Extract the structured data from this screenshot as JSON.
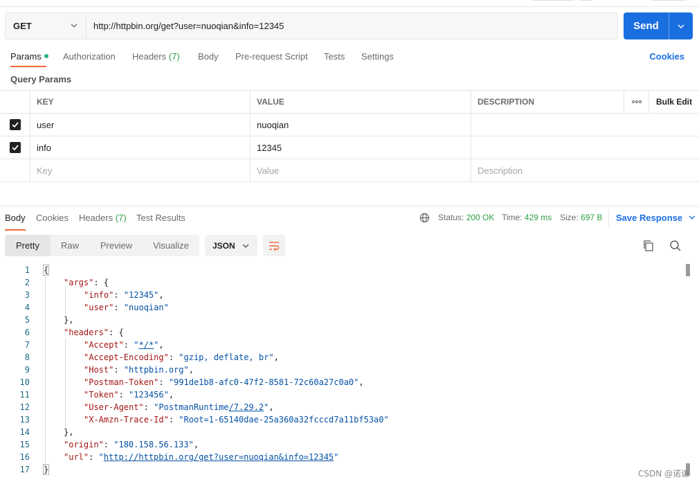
{
  "request": {
    "method": "GET",
    "url": "http://httpbin.org/get?user=nuoqian&info=12345",
    "send_label": "Send"
  },
  "request_tabs": [
    {
      "label": "Params",
      "active": true,
      "dot": true
    },
    {
      "label": "Authorization"
    },
    {
      "label": "Headers",
      "count": "(7)"
    },
    {
      "label": "Body"
    },
    {
      "label": "Pre-request Script"
    },
    {
      "label": "Tests"
    },
    {
      "label": "Settings"
    }
  ],
  "cookies_label": "Cookies",
  "query_params": {
    "title": "Query Params",
    "headers": {
      "key": "KEY",
      "value": "VALUE",
      "description": "DESCRIPTION",
      "bulk_edit": "Bulk Edit",
      "more": "ooo"
    },
    "rows": [
      {
        "checked": true,
        "key": "user",
        "value": "nuoqian",
        "description": ""
      },
      {
        "checked": true,
        "key": "info",
        "value": "12345",
        "description": ""
      }
    ],
    "placeholders": {
      "key": "Key",
      "value": "Value",
      "description": "Description"
    }
  },
  "response_tabs": [
    {
      "label": "Body",
      "active": true
    },
    {
      "label": "Cookies"
    },
    {
      "label": "Headers",
      "count": "(7)"
    },
    {
      "label": "Test Results"
    }
  ],
  "response_meta": {
    "status_label": "Status:",
    "status_value": "200 OK",
    "time_label": "Time:",
    "time_value": "429 ms",
    "size_label": "Size:",
    "size_value": "697 B",
    "save_label": "Save Response"
  },
  "view_modes": [
    "Pretty",
    "Raw",
    "Preview",
    "Visualize"
  ],
  "format": "JSON",
  "code_lines": [
    {
      "n": "1",
      "indent": 0,
      "parts": [
        [
          "p",
          "{"
        ]
      ]
    },
    {
      "n": "2",
      "indent": 1,
      "parts": [
        [
          "k",
          "\"args\""
        ],
        [
          "p",
          ": {"
        ]
      ]
    },
    {
      "n": "3",
      "indent": 2,
      "parts": [
        [
          "k",
          "\"info\""
        ],
        [
          "p",
          ": "
        ],
        [
          "s",
          "\"12345\""
        ],
        [
          "p",
          ","
        ]
      ]
    },
    {
      "n": "4",
      "indent": 2,
      "parts": [
        [
          "k",
          "\"user\""
        ],
        [
          "p",
          ": "
        ],
        [
          "s",
          "\"nuoqian\""
        ]
      ]
    },
    {
      "n": "5",
      "indent": 1,
      "parts": [
        [
          "p",
          "},"
        ]
      ]
    },
    {
      "n": "6",
      "indent": 1,
      "parts": [
        [
          "k",
          "\"headers\""
        ],
        [
          "p",
          ": {"
        ]
      ]
    },
    {
      "n": "7",
      "indent": 2,
      "parts": [
        [
          "k",
          "\"Accept\""
        ],
        [
          "p",
          ": "
        ],
        [
          "s",
          "\""
        ],
        [
          "u",
          "*/*"
        ],
        [
          "s",
          "\""
        ],
        [
          "p",
          ","
        ]
      ]
    },
    {
      "n": "8",
      "indent": 2,
      "parts": [
        [
          "k",
          "\"Accept-Encoding\""
        ],
        [
          "p",
          ": "
        ],
        [
          "s",
          "\"gzip, deflate, br\""
        ],
        [
          "p",
          ","
        ]
      ]
    },
    {
      "n": "9",
      "indent": 2,
      "parts": [
        [
          "k",
          "\"Host\""
        ],
        [
          "p",
          ": "
        ],
        [
          "s",
          "\"httpbin.org\""
        ],
        [
          "p",
          ","
        ]
      ]
    },
    {
      "n": "10",
      "indent": 2,
      "parts": [
        [
          "k",
          "\"Postman-Token\""
        ],
        [
          "p",
          ": "
        ],
        [
          "s",
          "\"991de1b8-afc0-47f2-8581-72c60a27c0a0\""
        ],
        [
          "p",
          ","
        ]
      ]
    },
    {
      "n": "11",
      "indent": 2,
      "parts": [
        [
          "k",
          "\"Token\""
        ],
        [
          "p",
          ": "
        ],
        [
          "s",
          "\"123456\""
        ],
        [
          "p",
          ","
        ]
      ]
    },
    {
      "n": "12",
      "indent": 2,
      "parts": [
        [
          "k",
          "\"User-Agent\""
        ],
        [
          "p",
          ": "
        ],
        [
          "s",
          "\"PostmanRuntime"
        ],
        [
          "u",
          "/7.29.2"
        ],
        [
          "s",
          "\""
        ],
        [
          "p",
          ","
        ]
      ]
    },
    {
      "n": "13",
      "indent": 2,
      "parts": [
        [
          "k",
          "\"X-Amzn-Trace-Id\""
        ],
        [
          "p",
          ": "
        ],
        [
          "s",
          "\"Root=1-65140dae-25a360a32fcccd7a11bf53a0\""
        ]
      ]
    },
    {
      "n": "14",
      "indent": 1,
      "parts": [
        [
          "p",
          "},"
        ]
      ]
    },
    {
      "n": "15",
      "indent": 1,
      "parts": [
        [
          "k",
          "\"origin\""
        ],
        [
          "p",
          ": "
        ],
        [
          "s",
          "\"180.158.56.133\""
        ],
        [
          "p",
          ","
        ]
      ]
    },
    {
      "n": "16",
      "indent": 1,
      "parts": [
        [
          "k",
          "\"url\""
        ],
        [
          "p",
          ": "
        ],
        [
          "s",
          "\""
        ],
        [
          "u",
          "http://httpbin.org/get?user=nuoqian&info=12345"
        ],
        [
          "s",
          "\""
        ]
      ]
    },
    {
      "n": "17",
      "indent": 0,
      "parts": [
        [
          "p",
          "}"
        ]
      ]
    }
  ],
  "watermark": "CSDN @诺谦"
}
